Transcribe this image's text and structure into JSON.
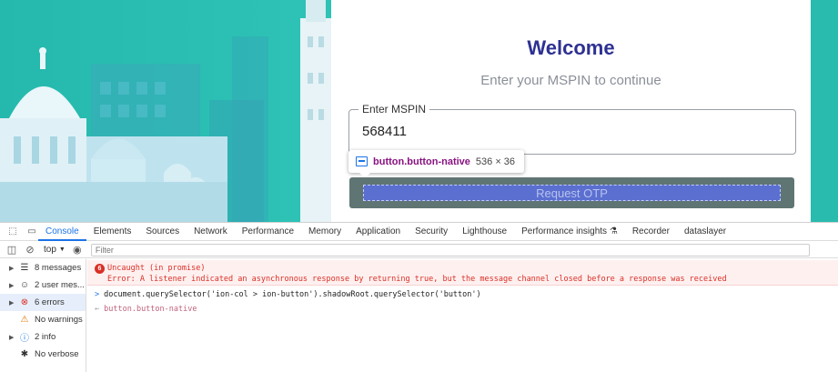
{
  "app": {
    "welcome": "Welcome",
    "subtitle": "Enter your MSPIN to continue",
    "field_label": "Enter MSPIN",
    "field_value": "568411",
    "button_label": "Request OTP",
    "inspect_tooltip": {
      "selector": "button.button-native",
      "size": "536 × 36"
    },
    "colors": {
      "brand": "#2e3192",
      "teal": "#2ec3b6"
    }
  },
  "devtools": {
    "tabs": [
      "Console",
      "Elements",
      "Sources",
      "Network",
      "Performance",
      "Memory",
      "Application",
      "Security",
      "Lighthouse",
      "Performance insights",
      "Recorder",
      "dataslayer"
    ],
    "active_tab": "Console",
    "context": "top",
    "filter_placeholder": "Filter",
    "sidebar": [
      {
        "label": "8 messages",
        "icon": "list-icon"
      },
      {
        "label": "2 user mes...",
        "icon": "user-icon"
      },
      {
        "label": "6 errors",
        "icon": "error-icon"
      },
      {
        "label": "No warnings",
        "icon": "warning-icon"
      },
      {
        "label": "2 info",
        "icon": "info-icon"
      },
      {
        "label": "No verbose",
        "icon": "bug-icon"
      }
    ],
    "error": {
      "count": "6",
      "title": "Uncaught (in promise)",
      "message": "Error: A listener indicated an asynchronous response by returning true, but the message channel closed before a response was received"
    },
    "command": "document.querySelector('ion-col > ion-button').shadowRoot.querySelector('button')",
    "result": "button.button-native"
  }
}
